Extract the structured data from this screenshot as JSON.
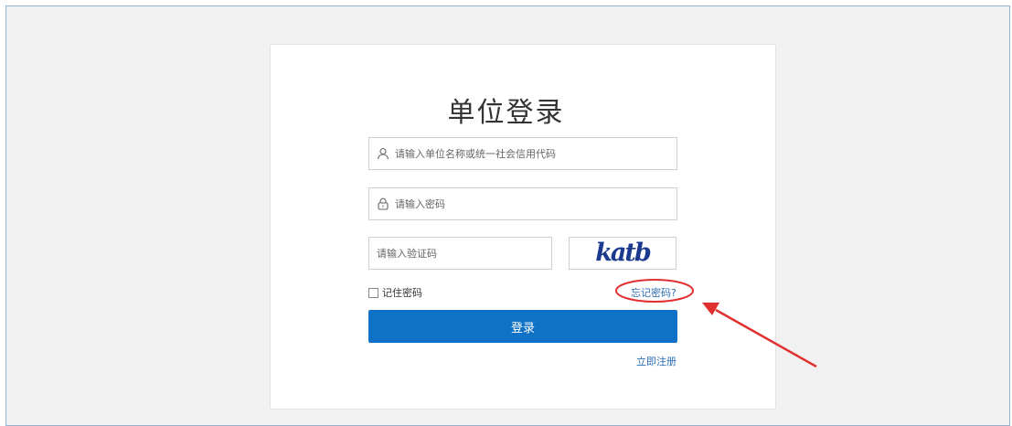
{
  "login": {
    "title": "单位登录",
    "username_placeholder": "请输入单位名称或统一社会信用代码",
    "password_placeholder": "请输入密码",
    "captcha_placeholder": "请输入验证码",
    "captcha_text": "katb",
    "remember_label": "记住密码",
    "forgot_label": "忘记密码?",
    "login_label": "登录",
    "register_label": "立即注册"
  },
  "colors": {
    "primary": "#0f72c6",
    "link": "#2d6db5",
    "annotation": "#e03030",
    "captcha": "#1b3a8f"
  },
  "icons": {
    "username": "user-icon",
    "password": "lock-icon"
  }
}
